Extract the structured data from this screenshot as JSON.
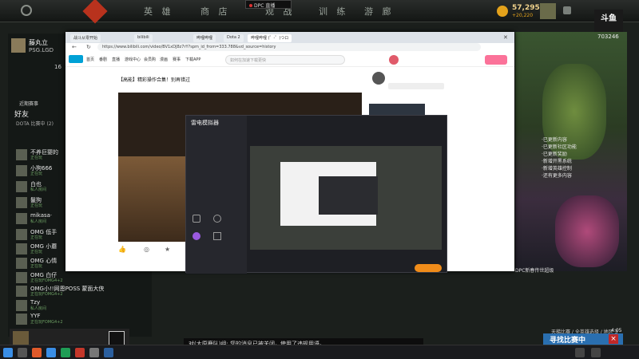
{
  "topbar": {
    "nav": [
      "英 雄",
      "商 店",
      "观 战",
      "训 练",
      "游 廊"
    ],
    "gold": "57,295",
    "gold_sub": "+20,220",
    "dpc": "DPC 直播"
  },
  "left": {
    "user": "藤丸立",
    "team": "PSG.LGD",
    "level": "16",
    "friends_title": "好友",
    "dota_friends": "DOTA 比赛中 (2)",
    "friends": [
      {
        "name": "不养巨婴的",
        "status": "正在玩"
      },
      {
        "name": "小狗666",
        "status": "正在玩"
      },
      {
        "name": "白也",
        "status": "私人房间"
      },
      {
        "name": "鬣狗",
        "status": "正在玩"
      },
      {
        "name": "mikasa·",
        "status": "私人房间"
      },
      {
        "name": "OMG 低手",
        "status": "正在玩"
      },
      {
        "name": "OMG 小蘑",
        "status": "正在玩"
      },
      {
        "name": "OMG 心情",
        "status": "正在玩"
      },
      {
        "name": "OMG 白仔",
        "status": "正在玩FOMG4+2"
      },
      {
        "name": "OMG小!!网恩POSS 蒙面大侠",
        "status": "正在玩FOMG4+2"
      },
      {
        "name": "Tzy",
        "status": "私人房间"
      },
      {
        "name": "YYF",
        "status": "正在玩FOMG4+2"
      }
    ],
    "recent": "近期赛事"
  },
  "browser": {
    "tabs": [
      "战斗从零开始",
      "bilibili",
      "哔哩哔哩",
      "Dota 2",
      "哔哩哔哩 (゜-゜)つロ"
    ],
    "url": "https://www.bilibili.com/video/BV1xDJ8z7rY?spm_id_from=333.788&vd_source=history",
    "nav": [
      "首页",
      "番剧",
      "直播",
      "游戏中心",
      "会员购",
      "漫画",
      "赛事",
      "下载APP"
    ],
    "search_placeholder": "如何在加速下载更快",
    "video_title": "【高能】精彩操作合集！别再错过",
    "app_title": "雷电模拟器"
  },
  "right": {
    "badge": "斗鱼",
    "room": "703246",
    "list": [
      "·已更新内容",
      "·已更新社区功能",
      "·已更新奖励",
      "·新增开黑系统",
      "·新增英雄控制",
      "·还有更多内容"
    ],
    "dpc_caption": "DPC新春传世超级"
  },
  "notification": "对(太原鹿队)组: 您的消息已被关闭，使用了违规用语。",
  "bottom": {
    "search": "寻找比赛中",
    "close": "×",
    "time": "4:05",
    "match_info": "天梯比赛 / 全英雄选择 / 地区 3"
  }
}
